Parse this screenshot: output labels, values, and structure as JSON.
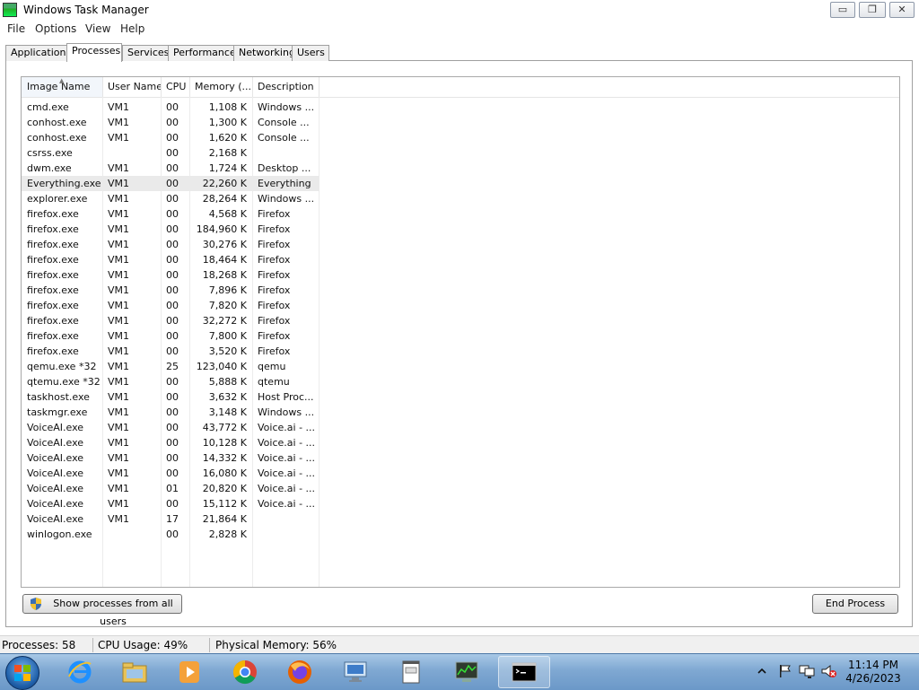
{
  "window": {
    "title": "Windows Task Manager",
    "controls": {
      "minimize": "▭",
      "maximize": "❐",
      "close": "✕"
    }
  },
  "menu": [
    "File",
    "Options",
    "View",
    "Help"
  ],
  "tabs": [
    "Applications",
    "Processes",
    "Services",
    "Performance",
    "Networking",
    "Users"
  ],
  "active_tab": "Processes",
  "columns": [
    "Image Name",
    "User Name",
    "CPU",
    "Memory (...",
    "Description"
  ],
  "sorted_column": "Image Name",
  "selected_row": "Everything.exe",
  "processes": [
    {
      "name": "cmd.exe",
      "user": "VM1",
      "cpu": "00",
      "mem": "1,108 K",
      "desc": "Windows ..."
    },
    {
      "name": "conhost.exe",
      "user": "VM1",
      "cpu": "00",
      "mem": "1,300 K",
      "desc": "Console ..."
    },
    {
      "name": "conhost.exe",
      "user": "VM1",
      "cpu": "00",
      "mem": "1,620 K",
      "desc": "Console ..."
    },
    {
      "name": "csrss.exe",
      "user": "",
      "cpu": "00",
      "mem": "2,168 K",
      "desc": ""
    },
    {
      "name": "dwm.exe",
      "user": "VM1",
      "cpu": "00",
      "mem": "1,724 K",
      "desc": "Desktop ..."
    },
    {
      "name": "Everything.exe",
      "user": "VM1",
      "cpu": "00",
      "mem": "22,260 K",
      "desc": "Everything"
    },
    {
      "name": "explorer.exe",
      "user": "VM1",
      "cpu": "00",
      "mem": "28,264 K",
      "desc": "Windows ..."
    },
    {
      "name": "firefox.exe",
      "user": "VM1",
      "cpu": "00",
      "mem": "4,568 K",
      "desc": "Firefox"
    },
    {
      "name": "firefox.exe",
      "user": "VM1",
      "cpu": "00",
      "mem": "184,960 K",
      "desc": "Firefox"
    },
    {
      "name": "firefox.exe",
      "user": "VM1",
      "cpu": "00",
      "mem": "30,276 K",
      "desc": "Firefox"
    },
    {
      "name": "firefox.exe",
      "user": "VM1",
      "cpu": "00",
      "mem": "18,464 K",
      "desc": "Firefox"
    },
    {
      "name": "firefox.exe",
      "user": "VM1",
      "cpu": "00",
      "mem": "18,268 K",
      "desc": "Firefox"
    },
    {
      "name": "firefox.exe",
      "user": "VM1",
      "cpu": "00",
      "mem": "7,896 K",
      "desc": "Firefox"
    },
    {
      "name": "firefox.exe",
      "user": "VM1",
      "cpu": "00",
      "mem": "7,820 K",
      "desc": "Firefox"
    },
    {
      "name": "firefox.exe",
      "user": "VM1",
      "cpu": "00",
      "mem": "32,272 K",
      "desc": "Firefox"
    },
    {
      "name": "firefox.exe",
      "user": "VM1",
      "cpu": "00",
      "mem": "7,800 K",
      "desc": "Firefox"
    },
    {
      "name": "firefox.exe",
      "user": "VM1",
      "cpu": "00",
      "mem": "3,520 K",
      "desc": "Firefox"
    },
    {
      "name": "qemu.exe *32",
      "user": "VM1",
      "cpu": "25",
      "mem": "123,040 K",
      "desc": "qemu"
    },
    {
      "name": "qtemu.exe *32",
      "user": "VM1",
      "cpu": "00",
      "mem": "5,888 K",
      "desc": "qtemu"
    },
    {
      "name": "taskhost.exe",
      "user": "VM1",
      "cpu": "00",
      "mem": "3,632 K",
      "desc": "Host Proc..."
    },
    {
      "name": "taskmgr.exe",
      "user": "VM1",
      "cpu": "00",
      "mem": "3,148 K",
      "desc": "Windows ..."
    },
    {
      "name": "VoiceAI.exe",
      "user": "VM1",
      "cpu": "00",
      "mem": "43,772 K",
      "desc": "Voice.ai - ..."
    },
    {
      "name": "VoiceAI.exe",
      "user": "VM1",
      "cpu": "00",
      "mem": "10,128 K",
      "desc": "Voice.ai - ..."
    },
    {
      "name": "VoiceAI.exe",
      "user": "VM1",
      "cpu": "00",
      "mem": "14,332 K",
      "desc": "Voice.ai - ..."
    },
    {
      "name": "VoiceAI.exe",
      "user": "VM1",
      "cpu": "00",
      "mem": "16,080 K",
      "desc": "Voice.ai - ..."
    },
    {
      "name": "VoiceAI.exe",
      "user": "VM1",
      "cpu": "01",
      "mem": "20,820 K",
      "desc": "Voice.ai - ..."
    },
    {
      "name": "VoiceAI.exe",
      "user": "VM1",
      "cpu": "00",
      "mem": "15,112 K",
      "desc": "Voice.ai - ..."
    },
    {
      "name": "VoiceAI.exe",
      "user": "VM1",
      "cpu": "17",
      "mem": "21,864 K",
      "desc": ""
    },
    {
      "name": "winlogon.exe",
      "user": "",
      "cpu": "00",
      "mem": "2,828 K",
      "desc": ""
    }
  ],
  "buttons": {
    "show_all": "Show processes from all users",
    "end_process": "End Process"
  },
  "status": {
    "processes": "Processes: 58",
    "cpu": "CPU Usage: 49%",
    "memory": "Physical Memory: 56%"
  },
  "taskbar": {
    "items": [
      "internet-explorer",
      "windows-explorer",
      "media-player",
      "chrome",
      "firefox",
      "remote-desktop",
      "notepad-app",
      "task-manager-app",
      "command-prompt"
    ],
    "active_item": "command-prompt",
    "clock_time": "11:14 PM",
    "clock_date": "4/26/2023"
  },
  "colors": {
    "taskbar": "#7fa8d2",
    "selected_row": "#eaeaea",
    "panel_border": "#a0a0a0"
  }
}
